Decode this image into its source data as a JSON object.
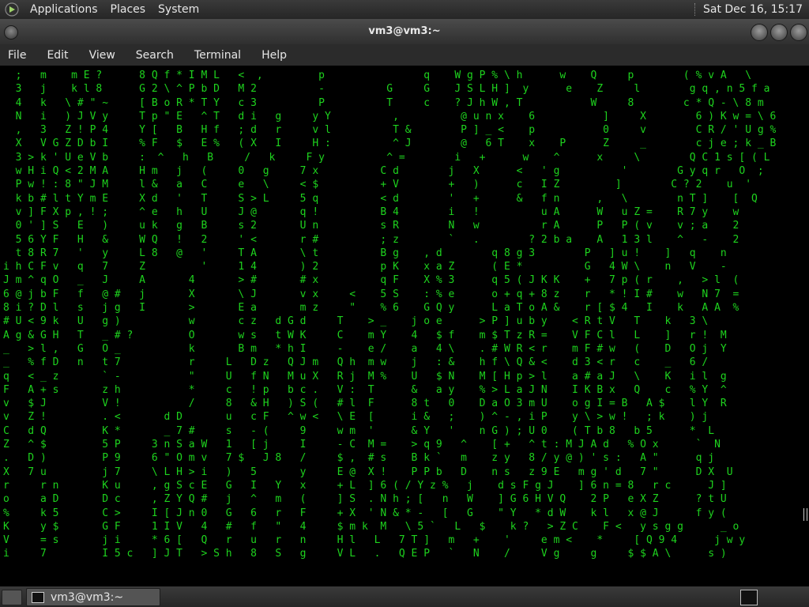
{
  "top_panel": {
    "menus": [
      "Applications",
      "Places",
      "System"
    ],
    "clock": "Sat Dec 16, 15:17",
    "icons": [
      "gnome-foot-icon"
    ]
  },
  "window": {
    "title": "vm3@vm3:~",
    "menu": [
      "File",
      "Edit",
      "View",
      "Search",
      "Terminal",
      "Help"
    ],
    "buttons": [
      "minimize",
      "maximize",
      "close"
    ]
  },
  "terminal": {
    "text_color": "#1ed31e",
    "lines": [
      "  ;   m    m E ?      8 Q f * I M L   <  ,         p                q    W g P % \\ h      w    Q     p        ( % v A   \\",
      "  3   j    k l 8      G 2 \\ ^ P b D   M 2          -          G     G    J S L H ]  y      e    Z     l        g q , n 5 f a",
      "  4   k   \\ # \" ~     [ B o R * T Y   c 3          P          T     c    ? J h W , T           W     8        c * Q - \\ 8 m",
      "  N   i   ) J V y     T p \" E   ^ T   d i   g     y Y          ,          @ u n x    6           ]     X        6 ) K w = \\ 6",
      "  ,   3   Z ! P 4     Y [   B   H f   ; d   r     v l          T &        P ] _ <    p           0     v        C R / ' U g %",
      "  X   V G Z D b I     % F   $   E %   ( X   I     H :          ^ J        @   6 T    x    P      Z     _        c j e ; k _ B",
      "  3 > k ' U e V b     :  ^   h   B     /   k     F y          ^ =        i   +      w    ^      x     \\        Q C 1 s [ ( L",
      "  w H i Q < 2 M A     H m   j   (     0   g     7 x          C d        j   X      <   ' g          '        G y q r   O  ;",
      "  P w ! : 8 \" J M     l &   a   C     e   \\     < $          + V        +   )      c   I Z         ]        C ? 2    u  '",
      "  k b # l t Y m E     X d   '   T     S > L     5 q          < d        '   +      &   f n      ,   \\        n T ]    [  Q",
      "  v ] F X p , ! ;     ^ e   h   U     J @       q !          B 4        i   !          u A      W   u Z =    R 7 y    w",
      "  0 ' ] S   E   )     u k   g   B     s 2       U n          s R        N   w          r A      P   P ( v    v ; a    2",
      "  5 6 Y F   H   &     W Q   !   2     ' <       r #          ; z        `   .        ? 2 b a    A   1 3 l    ^   -    2",
      "  t 8 R 7   '   y     L 8   @   '     T A       \\ t          B g    , d        q 8 g 3        P   ] u !    ]   q    n",
      "i h C F v   q   7     Z         '     1 4       ) 2          p K    x a Z      ( E *          G   4 W \\    n   V    -",
      "J m ^ q O   _   J     A       4       > #       # x          q F    X % 3      q 5 ( J K K    +   7 p ( r    ,   > l  (",
      "6 @ j b F   f   @ #   j       X       \\ J       v x     <    5 S    : % e      o + q + 8 z    r   * ! I #    w   N 7  =",
      "8 i ? D l   s   j g   I       >       E a       m z     \"    % 6    G Q y      L a T o A &    r [ $ 4   I    k   A A  %",
      "# U < 9 k   U   g )           w       c z   d G d     T    > _    j o e      > P ] u b y    < R t V   T    k   3 \\  ",
      "A g & G H   T   _ # ?         O       w s   t W K     C    m Y    4   $ f    m $ T z R =    V F C l   L    ]   r !  M",
      "_   > l ,   G   O _           k       B m   * h I     -    e /    a   4 \\    . # W R < r    m F # w   (    D   O j  Y",
      "_   % f D   n   t 7           r     L   D z   Q J m   Q h  m w    j   : &    h f \\ Q & <    d 3 < r   c    _   6 /  ",
      "q   < _ z       ` -           \"     U   f N   M u X   R j  M %    U   $ N    M [ H p > l    a # a J   \\    K   i l  g",
      "F   A + s       z h           *     c   ! p   b c .   V :  T      &   a y    % > L a J N    I K B x   Q    c   % Y  ^",
      "v   $ J         V !           /     8   & H   ) S (   # l  F      8 t   0    D a O 3 m U    o g I = B   A $    l Y  R",
      "v   Z !         . <       d D       u   c F   ^ w <   \\ E  [      i &   ;    ) ^ - , i P    y \\ > w !   ; k    ) j  ",
      "C   d Q         K *       _ 7 #     s   - (     9     w m  '      & Y   '    n G ) ; U 0    ( T b 8   b 5      *  L",
      "Z   ^ $         5 P     3 n S a W   1   [ j     I     - C  M =    > q 9   ^    [ +   ^ t : M J A d   % O x      `  N",
      ".   D )         P 9     6 \" O m v   7 $   J 8   /     $ ,  # s    B k `   m    z y   8 / y @ ) ' s :   A \"      q j  ",
      "X   7 u         j 7     \\ L H > i   )   5       y     E @  X !    P P b   D    n s   z 9 E   m g ' d   7 \"      D X  U",
      "r     r n       K u     , g S c E   G   I   Y   x     + L  ] 6 ( / Y z %   j    d s F g J    ] 6 n = 8   r c      J ]",
      "o     a D       D c     , Z Y Q #   j   ^   m   (     ] S  . N h ; [   n   W    ] G 6 H V Q    2 P   e X Z      ? t U",
      "%     k 5       C >     I [ J n 0   G   6   r   F     + X  ' N & * -   [   G    \" Y   * d W    k l   x @ J      f y (",
      "K     y $       G F     1 I V   4   #   f   \"   4     $ m k  M   \\ 5 `   L   $    k ?   > Z C    F <   y s g g      _ o",
      "V     = s       j i     * 6 [   Q   r   u   r   n     H l   L   7 T ]   m   +    '     e m <    *     [ Q 9 4      j w y",
      "i     7         I 5 c   ] J T   > S h   8   S   g     V L   .   Q E P   `   N    /     V g     g     $ $ A \\      s )"
    ]
  },
  "taskbar": {
    "tasks": [
      "vm3@vm3:~"
    ]
  }
}
